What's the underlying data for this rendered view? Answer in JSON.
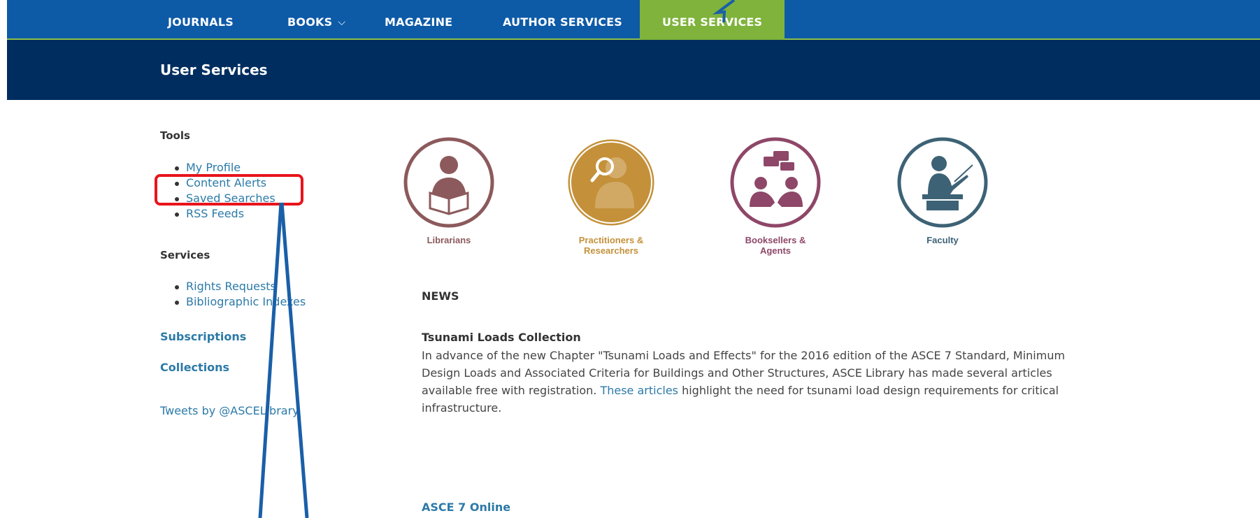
{
  "nav": {
    "items": [
      {
        "label": "JOURNALS"
      },
      {
        "label": "BOOKS",
        "chevron": "⌵"
      },
      {
        "label": "MAGAZINE"
      },
      {
        "label": "AUTHOR SERVICES"
      },
      {
        "label": "USER SERVICES",
        "active": true
      }
    ]
  },
  "section": {
    "title": "User Services"
  },
  "sidebar": {
    "tools_heading": "Tools",
    "tools": [
      "My Profile",
      "Content Alerts",
      "Saved Searches",
      "RSS Feeds"
    ],
    "services_heading": "Services",
    "services": [
      "Rights Requests",
      "Bibliographic Indexes"
    ],
    "subscriptions": "Subscriptions",
    "collections": "Collections",
    "tweets": "Tweets by @ASCELibrary"
  },
  "audiences": [
    {
      "label": "Librarians",
      "color": "#8c5a5c",
      "icon": "reader-icon"
    },
    {
      "label": "Practitioners &\nResearchers",
      "color": "#c4913a",
      "icon": "researcher-magnifier-icon"
    },
    {
      "label": "Booksellers &\nAgents",
      "color": "#8e4768",
      "icon": "conversation-people-icon"
    },
    {
      "label": "Faculty",
      "color": "#3d6275",
      "icon": "teacher-podium-icon"
    }
  ],
  "news": {
    "heading": "NEWS",
    "article_title": "Tsunami Loads Collection",
    "article_text_1": "In advance of the new Chapter \"Tsunami Loads and Effects\" for the 2016 edition of the ASCE 7 Standard, Minimum Design Loads and Associated Criteria for Buildings and Other Structures, ASCE Library has made several articles available free with registration. ",
    "article_link": "These articles",
    "article_text_2": " highlight the need for tsunami load design requirements for critical infrastructure.",
    "second_title": "ASCE 7 Online"
  },
  "colors": {
    "nav_bg": "#0d5aa7",
    "nav_active": "#7fb33c",
    "section_bg": "#002d5f",
    "link": "#2c7aa8",
    "highlight_box": "#e8141c",
    "annotation_arrow": "#1a5fa8"
  }
}
